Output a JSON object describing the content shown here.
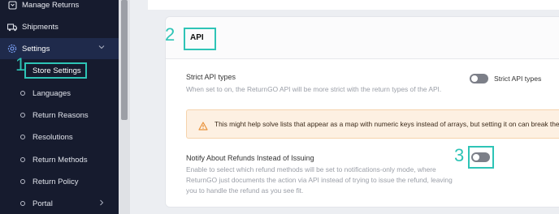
{
  "sidebar": {
    "items": [
      {
        "label": "Manage Returns",
        "icon": "box-icon"
      },
      {
        "label": "Shipments",
        "icon": "truck-icon"
      },
      {
        "label": "Settings",
        "icon": "gear-icon"
      }
    ],
    "sub_items": [
      {
        "label": "Store Settings"
      },
      {
        "label": "Languages"
      },
      {
        "label": "Return Reasons"
      },
      {
        "label": "Resolutions"
      },
      {
        "label": "Return Methods"
      },
      {
        "label": "Return Policy"
      },
      {
        "label": "Portal"
      }
    ]
  },
  "annotations": {
    "step1": "1",
    "step2": "2",
    "step3": "3"
  },
  "section": {
    "title": "API"
  },
  "strict": {
    "label": "Strict API types",
    "description": "When set to on, the ReturnGO API will be more strict with the return types of the API.",
    "toggle_label": "Strict API types",
    "enabled": false
  },
  "warning": {
    "text": "This might help solve lists that appear as a map with numeric keys instead of arrays, but setting it on can break the",
    "icon": "warning-icon"
  },
  "notify": {
    "label": "Notify About Refunds Instead of Issuing",
    "description_lines": [
      "Enable to select which refund methods will be set to notifications-only mode, where",
      "ReturnGO just documents the action via API instead of trying to issue the refund, leaving",
      "you to handle the refund as you see fit."
    ],
    "enabled": false
  },
  "colors": {
    "accent": "#2ec4b6",
    "sidebar": "#161b2e",
    "warning_bg": "#fdf0e2"
  }
}
